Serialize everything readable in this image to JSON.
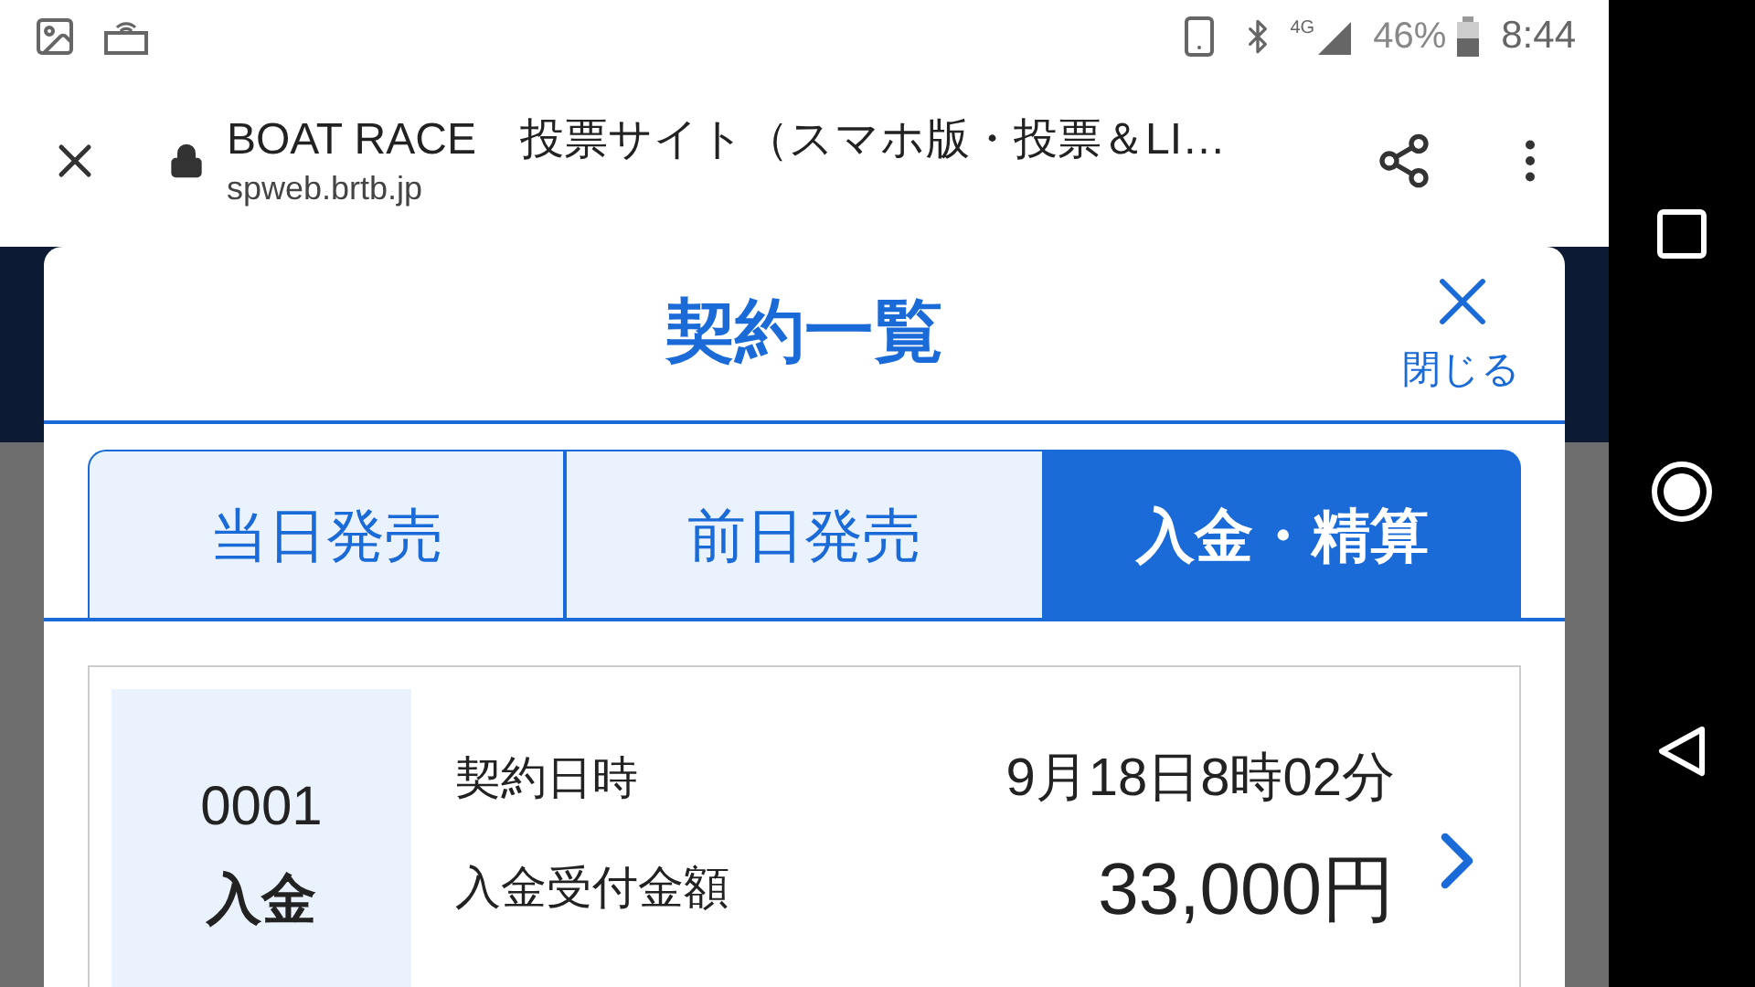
{
  "status_bar": {
    "network": "4G",
    "battery": "46%",
    "time": "8:44"
  },
  "browser": {
    "title": "BOAT RACE　投票サイト（スマホ版・投票＆LI…",
    "url": "spweb.brtb.jp"
  },
  "modal": {
    "title": "契約一覧",
    "close_label": "閉じる"
  },
  "tabs": [
    {
      "label": "当日発売",
      "selected": false
    },
    {
      "label": "前日発売",
      "selected": false
    },
    {
      "label": "入金・精算",
      "selected": true
    }
  ],
  "contracts": [
    {
      "number": "0001",
      "type": "入金",
      "rows": [
        {
          "kind": "datetime",
          "label": "契約日時",
          "value": "9月18日8時02分"
        },
        {
          "kind": "amount",
          "label": "入金受付金額",
          "value": "33,000円"
        }
      ]
    }
  ]
}
